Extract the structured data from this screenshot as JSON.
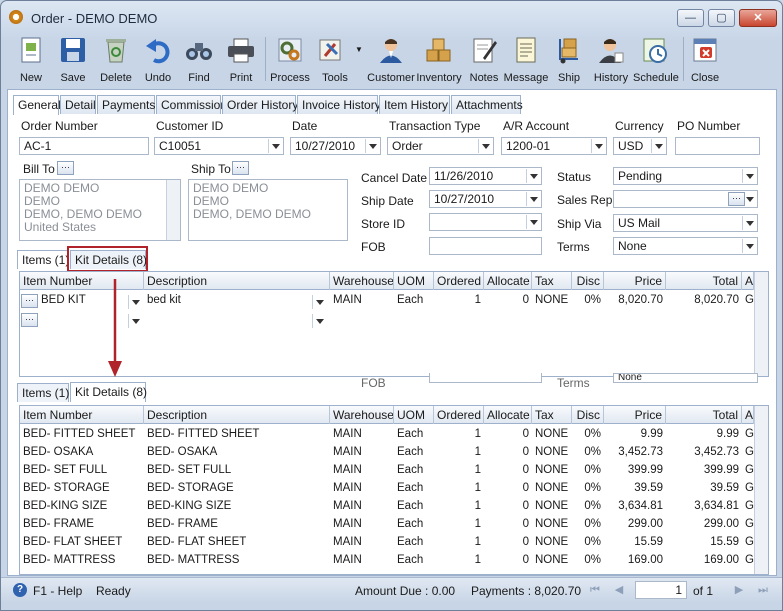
{
  "window": {
    "title": "Order - DEMO DEMO"
  },
  "toolbar": {
    "items": [
      {
        "label": "New",
        "icon": "new-document-icon"
      },
      {
        "label": "Save",
        "icon": "floppy-disk-icon"
      },
      {
        "label": "Delete",
        "icon": "recycle-bin-icon"
      },
      {
        "label": "Undo",
        "icon": "undo-arrow-icon"
      },
      {
        "label": "Find",
        "icon": "binoculars-icon"
      },
      {
        "label": "Print",
        "icon": "printer-icon"
      },
      {
        "label": "Process",
        "icon": "gears-icon"
      },
      {
        "label": "Tools",
        "icon": "tools-icon"
      },
      {
        "label": "Customer",
        "icon": "customer-person-icon"
      },
      {
        "label": "Inventory",
        "icon": "boxes-icon"
      },
      {
        "label": "Notes",
        "icon": "notes-pencil-icon"
      },
      {
        "label": "Message",
        "icon": "message-document-icon"
      },
      {
        "label": "Ship",
        "icon": "hand-truck-icon"
      },
      {
        "label": "History",
        "icon": "history-person-icon"
      },
      {
        "label": "Schedule",
        "icon": "schedule-clock-icon"
      },
      {
        "label": "Close",
        "icon": "close-window-icon"
      }
    ]
  },
  "tabs": [
    "General",
    "Detail",
    "Payments",
    "Commission",
    "Order History",
    "Invoice History",
    "Item History",
    "Attachments"
  ],
  "header": {
    "order_number_label": "Order Number",
    "order_number": "AC-1",
    "customer_id_label": "Customer ID",
    "customer_id": "C10051",
    "date_label": "Date",
    "date": "10/27/2010",
    "transaction_type_label": "Transaction Type",
    "transaction_type": "Order",
    "ar_account_label": "A/R Account",
    "ar_account": "1200-01",
    "currency_label": "Currency",
    "currency": "USD",
    "po_number_label": "PO Number",
    "po_number": ""
  },
  "bill_to": {
    "label": "Bill To",
    "lines": [
      "DEMO DEMO",
      "DEMO",
      "DEMO, DEMO DEMO",
      "United States"
    ]
  },
  "ship_to": {
    "label": "Ship To",
    "lines": [
      "DEMO DEMO",
      "DEMO",
      "DEMO, DEMO DEMO"
    ]
  },
  "mid": {
    "cancel_date_label": "Cancel  Date",
    "cancel_date": "11/26/2010",
    "ship_date_label": "Ship Date",
    "ship_date": "10/27/2010",
    "store_id_label": "Store ID",
    "store_id": "",
    "fob_label": "FOB",
    "fob": "",
    "status_label": "Status",
    "status": "Pending",
    "sales_rep_label": "Sales Rep",
    "sales_rep": "",
    "ship_via_label": "Ship Via",
    "ship_via": "US Mail",
    "terms_label": "Terms",
    "terms": "None"
  },
  "items_tabs": {
    "items": "Items (1)",
    "kit": "Kit Details (8)"
  },
  "columns": [
    "Item Number",
    "Description",
    "Warehouse",
    "UOM",
    "Ordered",
    "Allocate",
    "Tax",
    "Disc",
    "Price",
    "Total",
    "A"
  ],
  "items_grid": {
    "rows": [
      {
        "item": "BED KIT",
        "desc": "bed kit",
        "wh": "MAIN",
        "uom": "Each",
        "ordered": "1",
        "allocate": "0",
        "tax": "NONE",
        "disc": "0%",
        "price": "8,020.70",
        "total": "8,020.70",
        "a": "G"
      }
    ]
  },
  "ghost": {
    "fob": "FOB",
    "terms": "Terms",
    "terms_value": "None"
  },
  "kit_grid": {
    "rows": [
      {
        "item": "BED- FITTED SHEET",
        "desc": "BED- FITTED SHEET",
        "wh": "MAIN",
        "uom": "Each",
        "ordered": "1",
        "allocate": "0",
        "tax": "NONE",
        "disc": "0%",
        "price": "9.99",
        "total": "9.99",
        "a": "G"
      },
      {
        "item": "BED- OSAKA",
        "desc": "BED- OSAKA",
        "wh": "MAIN",
        "uom": "Each",
        "ordered": "1",
        "allocate": "0",
        "tax": "NONE",
        "disc": "0%",
        "price": "3,452.73",
        "total": "3,452.73",
        "a": "G"
      },
      {
        "item": "BED- SET FULL",
        "desc": "BED- SET FULL",
        "wh": "MAIN",
        "uom": "Each",
        "ordered": "1",
        "allocate": "0",
        "tax": "NONE",
        "disc": "0%",
        "price": "399.99",
        "total": "399.99",
        "a": "G"
      },
      {
        "item": "BED- STORAGE",
        "desc": "BED- STORAGE",
        "wh": "MAIN",
        "uom": "Each",
        "ordered": "1",
        "allocate": "0",
        "tax": "NONE",
        "disc": "0%",
        "price": "39.59",
        "total": "39.59",
        "a": "G"
      },
      {
        "item": "BED-KING SIZE",
        "desc": "BED-KING SIZE",
        "wh": "MAIN",
        "uom": "Each",
        "ordered": "1",
        "allocate": "0",
        "tax": "NONE",
        "disc": "0%",
        "price": "3,634.81",
        "total": "3,634.81",
        "a": "G"
      },
      {
        "item": "BED- FRAME",
        "desc": "BED- FRAME",
        "wh": "MAIN",
        "uom": "Each",
        "ordered": "1",
        "allocate": "0",
        "tax": "NONE",
        "disc": "0%",
        "price": "299.00",
        "total": "299.00",
        "a": "G"
      },
      {
        "item": "BED- FLAT SHEET",
        "desc": "BED- FLAT SHEET",
        "wh": "MAIN",
        "uom": "Each",
        "ordered": "1",
        "allocate": "0",
        "tax": "NONE",
        "disc": "0%",
        "price": "15.59",
        "total": "15.59",
        "a": "G"
      },
      {
        "item": "BED- MATTRESS",
        "desc": "BED- MATTRESS",
        "wh": "MAIN",
        "uom": "Each",
        "ordered": "1",
        "allocate": "0",
        "tax": "NONE",
        "disc": "0%",
        "price": "169.00",
        "total": "169.00",
        "a": "G"
      }
    ]
  },
  "status": {
    "help": "F1 - Help",
    "ready": "Ready",
    "amount_due": "Amount Due : 0.00",
    "payments": "Payments : 8,020.70",
    "page": "1",
    "of": "of  1"
  },
  "colors": {
    "highlight": "#b0232a",
    "header_bg": "#e1e8f1",
    "border": "#9db1cc"
  }
}
